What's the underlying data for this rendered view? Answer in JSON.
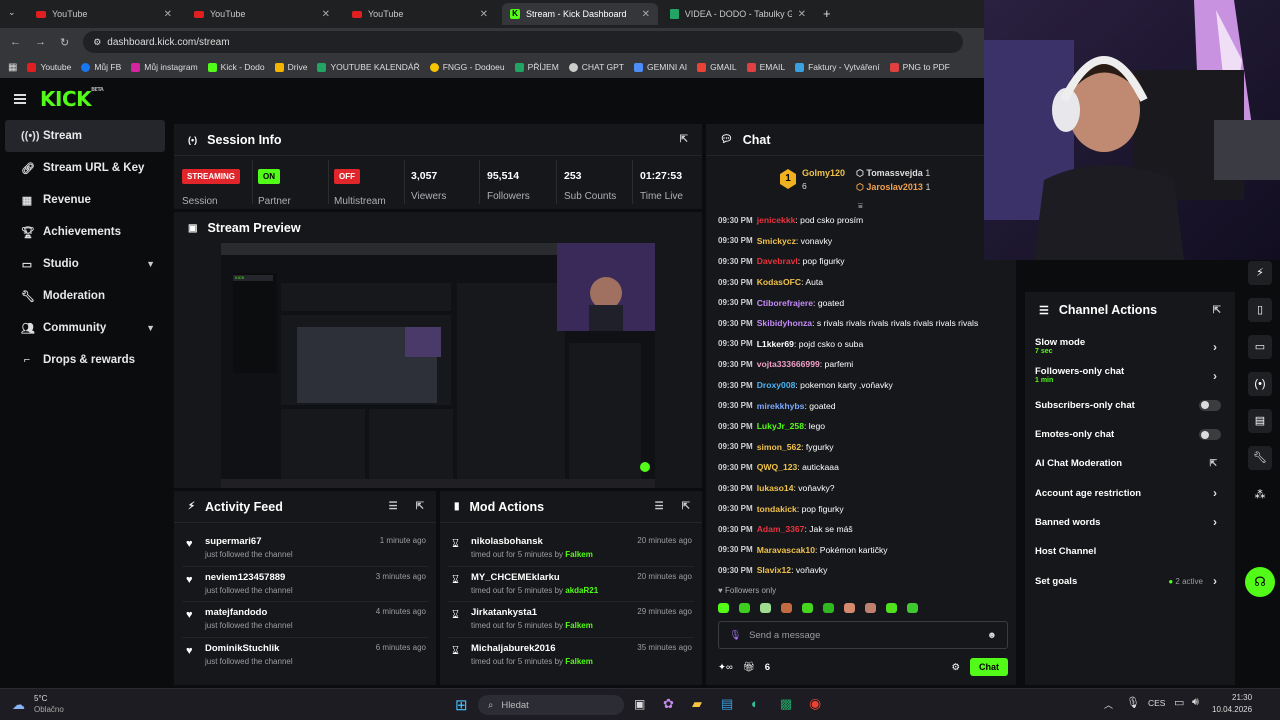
{
  "browser": {
    "tabs": [
      {
        "title": "YouTube",
        "icon": "youtube-icon"
      },
      {
        "title": "YouTube",
        "icon": "youtube-icon"
      },
      {
        "title": "YouTube",
        "icon": "youtube-icon"
      },
      {
        "title": "Stream - Kick Dashboard",
        "icon": "kick-icon"
      },
      {
        "title": "VIDEA - DODO - Tabulky Googl",
        "icon": "sheets-icon"
      }
    ],
    "url": "dashboard.kick.com/stream",
    "bookmarks": [
      {
        "label": "Youtube",
        "color": "#e02020"
      },
      {
        "label": "Můj FB",
        "color": "#1877f2"
      },
      {
        "label": "Můj instagram",
        "color": "#d6249f"
      },
      {
        "label": "Kick - Dodo",
        "color": "#53fc18"
      },
      {
        "label": "Drive",
        "color": "#f4b400"
      },
      {
        "label": "YOUTUBE KALENDÁŘ",
        "color": "#21a464"
      },
      {
        "label": "FNGG - Dodoeu",
        "color": "#f7c400"
      },
      {
        "label": "PŘÍJEM",
        "color": "#21a464"
      },
      {
        "label": "CHAT GPT",
        "color": "#cccccc"
      },
      {
        "label": "GEMINI AI",
        "color": "#4c8df6"
      },
      {
        "label": "GMAIL",
        "color": "#ea4335"
      },
      {
        "label": "EMAIL",
        "color": "#e04040"
      },
      {
        "label": "Faktury - Vytváření",
        "color": "#3aa0e0"
      },
      {
        "label": "PNG to PDF",
        "color": "#e04040"
      }
    ]
  },
  "brand": {
    "logo": "KICK",
    "beta": "BETA",
    "accent": "#53fc18"
  },
  "sidebar": {
    "items": [
      {
        "label": "Stream",
        "icon": "broadcast-icon"
      },
      {
        "label": "Stream URL & Key",
        "icon": "link-icon"
      },
      {
        "label": "Revenue",
        "icon": "revenue-icon"
      },
      {
        "label": "Achievements",
        "icon": "trophy-icon"
      },
      {
        "label": "Studio",
        "icon": "studio-icon"
      },
      {
        "label": "Moderation",
        "icon": "wrench-icon"
      },
      {
        "label": "Community",
        "icon": "community-icon"
      },
      {
        "label": "Drops & rewards",
        "icon": "gift-icon"
      }
    ]
  },
  "session": {
    "title": "Session Info",
    "status_badge": "STREAMING",
    "status_label": "Session",
    "partner_badge": "ON",
    "partner_label": "Partner",
    "multistream_badge": "OFF",
    "multistream_label": "Multistream",
    "viewers": "3,057",
    "viewers_label": "Viewers",
    "followers": "95,514",
    "followers_label": "Followers",
    "subs": "253",
    "subs_label": "Sub Counts",
    "time_live": "01:27:53",
    "time_label": "Time Live"
  },
  "preview": {
    "title": "Stream Preview"
  },
  "activity": {
    "title": "Activity Feed",
    "items": [
      {
        "name": "supermari67",
        "text": "just followed the channel",
        "time": "1 minute ago"
      },
      {
        "name": "neviem123457889",
        "text": "just followed the channel",
        "time": "3 minutes ago"
      },
      {
        "name": "matejfandodo",
        "text": "just followed the channel",
        "time": "4 minutes ago"
      },
      {
        "name": "DominikStuchlik",
        "text": "just followed the channel",
        "time": "6 minutes ago"
      }
    ]
  },
  "mod": {
    "title": "Mod Actions",
    "items": [
      {
        "name": "nikolasbohansk",
        "text": "timed out for 5 minutes by ",
        "by": "Falkem",
        "time": "20 minutes ago"
      },
      {
        "name": "MY_CHCEMEklarku",
        "text": "timed out for 5 minutes by ",
        "by": "akdaR21",
        "time": "20 minutes ago"
      },
      {
        "name": "Jirkatankysta1",
        "text": "timed out for 5 minutes by ",
        "by": "Falkem",
        "time": "29 minutes ago"
      },
      {
        "name": "Michaljaburek2016",
        "text": "timed out for 5 minutes by ",
        "by": "Falkem",
        "time": "35 minutes ago"
      }
    ]
  },
  "chat": {
    "title": "Chat",
    "leaderboard": [
      {
        "rank": "1",
        "name": "Golmy120",
        "count": "6"
      },
      {
        "name": "Tomassvejda",
        "count": "1"
      },
      {
        "name": "Jaroslav2013",
        "count": "1"
      }
    ],
    "messages": [
      {
        "time": "09:30 PM",
        "user": "jenicekkk",
        "color": "#e8333f",
        "text": ": pod csko prosím"
      },
      {
        "time": "09:30 PM",
        "user": "Smickycz",
        "color": "#f0c24a",
        "text": ": vonavky"
      },
      {
        "time": "09:30 PM",
        "user": "Davebravl",
        "color": "#e8333f",
        "text": ": pop figurky"
      },
      {
        "time": "09:30 PM",
        "user": "KodasOFC",
        "color": "#f0c24a",
        "text": ": Auta"
      },
      {
        "time": "09:30 PM",
        "user": "Ctiborefrajere",
        "color": "#c58af9",
        "text": ": goated"
      },
      {
        "time": "09:30 PM",
        "user": "Skibidyhonza",
        "color": "#c58af9",
        "text": ": s rivals rivals rivals rivals rivals rivals rivals"
      },
      {
        "time": "09:30 PM",
        "user": "L1kker69",
        "color": "#ffffff",
        "text": ": pojd csko o suba"
      },
      {
        "time": "09:30 PM",
        "user": "vojta333666999",
        "color": "#f0a0c8",
        "text": ": parfemi"
      },
      {
        "time": "09:30 PM",
        "user": "Droxy008",
        "color": "#4ab3f4",
        "text": ": pokemon karty ,voňavky"
      },
      {
        "time": "09:30 PM",
        "user": "mirekkhybs",
        "color": "#7aa8ff",
        "text": ": goated"
      },
      {
        "time": "09:30 PM",
        "user": "LukyJr_258",
        "color": "#53fc18",
        "text": ": lego"
      },
      {
        "time": "09:30 PM",
        "user": "simon_562",
        "color": "#f0c24a",
        "text": ": fygurky"
      },
      {
        "time": "09:30 PM",
        "user": "QWQ_123",
        "color": "#f0c24a",
        "text": ": autickaaa"
      },
      {
        "time": "09:30 PM",
        "user": "lukaso14",
        "color": "#f0c24a",
        "text": ": voňavky?"
      },
      {
        "time": "09:30 PM",
        "user": "tondakick",
        "color": "#f0c24a",
        "text": ": pop figurky"
      },
      {
        "time": "09:30 PM",
        "user": "Adam_3367",
        "color": "#e8333f",
        "text": ": Jak se máš"
      },
      {
        "time": "09:30 PM",
        "user": "Maravascak10",
        "color": "#f0c24a",
        "text": ": Pokémon kartičky"
      },
      {
        "time": "09:30 PM",
        "user": "Slavix12",
        "color": "#f0c24a",
        "text": ": voňavky"
      }
    ],
    "followers_only": "Followers only",
    "placeholder": "Send a message",
    "viewer_count": "6",
    "send_label": "Chat"
  },
  "channel_actions": {
    "title": "Channel Actions",
    "items": [
      {
        "label": "Slow mode",
        "sub": "7 sec",
        "control": "arrow"
      },
      {
        "label": "Followers-only chat",
        "sub": "1 min",
        "control": "arrow"
      },
      {
        "label": "Subscribers-only chat",
        "sub": "",
        "control": "toggle"
      },
      {
        "label": "Emotes-only chat",
        "sub": "",
        "control": "toggle"
      },
      {
        "label": "AI Chat Moderation",
        "sub": "",
        "control": "popout"
      },
      {
        "label": "Account age restriction",
        "sub": "",
        "control": "arrow"
      },
      {
        "label": "Banned words",
        "sub": "",
        "control": "arrow"
      },
      {
        "label": "Host Channel",
        "sub": "",
        "control": "none"
      },
      {
        "label": "Set goals",
        "sub": "",
        "control": "arrow",
        "status": "2 active"
      }
    ]
  },
  "taskbar": {
    "weather_temp": "5°C",
    "weather_text": "Oblačno",
    "search_placeholder": "Hledat",
    "lang": "CES",
    "time": "21:30",
    "date": "10.04.2026"
  }
}
